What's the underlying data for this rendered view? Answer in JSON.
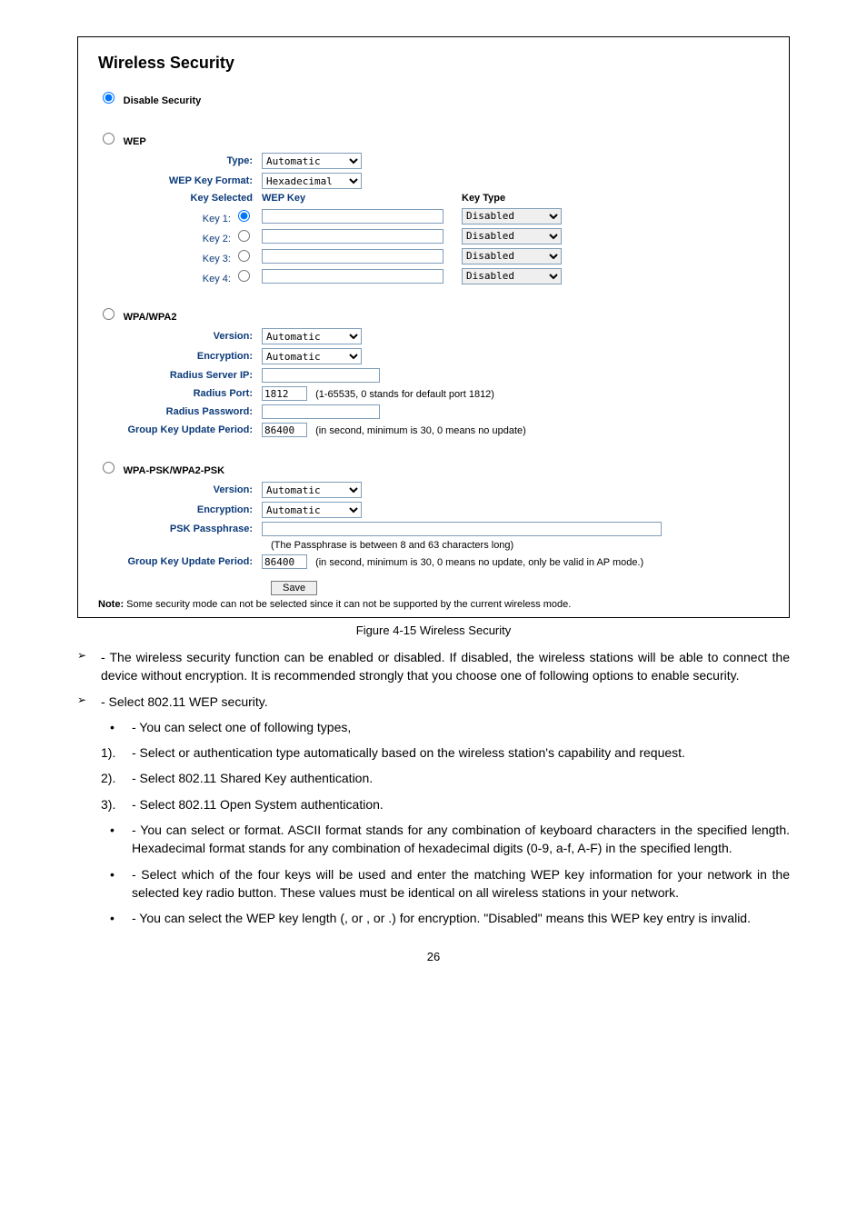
{
  "panel": {
    "title": "Wireless Security",
    "disable_label": "Disable Security",
    "wep": {
      "label": "WEP",
      "type_label": "Type:",
      "type_value": "Automatic",
      "format_label": "WEP Key Format:",
      "format_value": "Hexadecimal",
      "key_selected_label": "Key Selected",
      "wep_key_label": "WEP Key",
      "key_type_label": "Key Type",
      "keys": [
        {
          "label": "Key 1:",
          "type": "Disabled",
          "checked": true
        },
        {
          "label": "Key 2:",
          "type": "Disabled",
          "checked": false
        },
        {
          "label": "Key 3:",
          "type": "Disabled",
          "checked": false
        },
        {
          "label": "Key 4:",
          "type": "Disabled",
          "checked": false
        }
      ]
    },
    "wpa": {
      "label": "WPA/WPA2",
      "version_label": "Version:",
      "version_value": "Automatic",
      "encryption_label": "Encryption:",
      "encryption_value": "Automatic",
      "server_ip_label": "Radius Server IP:",
      "port_label": "Radius Port:",
      "port_value": "1812",
      "port_hint": "(1-65535, 0 stands for default port 1812)",
      "password_label": "Radius Password:",
      "gkup_label": "Group Key Update Period:",
      "gkup_value": "86400",
      "gkup_hint": "(in second, minimum is 30, 0 means no update)"
    },
    "psk": {
      "label": "WPA-PSK/WPA2-PSK",
      "version_label": "Version:",
      "version_value": "Automatic",
      "encryption_label": "Encryption:",
      "encryption_value": "Automatic",
      "pass_label": "PSK Passphrase:",
      "pass_hint": "(The Passphrase is between 8 and 63 characters long)",
      "gkup_label": "Group Key Update Period:",
      "gkup_value": "86400",
      "gkup_hint": "(in second, minimum is 30, 0 means no update, only be valid in AP mode.)"
    },
    "save_label": "Save",
    "note_bold": "Note:",
    "note_text": "  Some security mode can not be selected since it can not be supported by the current wireless mode."
  },
  "caption": "Figure 4-15 Wireless Security",
  "doc": {
    "p1": " - The wireless security function can be enabled or disabled. If disabled, the wireless stations will be able to connect the device without encryption. It is recommended strongly that you choose one of following options to enable security.",
    "p2": " - Select 802.11 WEP security.",
    "b1": " - You can select one of following types,",
    "n1_pre": " - Select ",
    "n1_mid": " or ",
    "n1_post": " authentication type automatically based on the wireless station's capability and request.",
    "n2": " - Select 802.11 Shared Key authentication.",
    "n3": " - Select 802.11 Open System authentication.",
    "b2_pre": " - You can select ",
    "b2_mid": " or ",
    "b2_post": " format. ASCII format stands for any combination of keyboard characters in the specified length. Hexadecimal format stands for any combination of hexadecimal digits (0-9, a-f, A-F) in the specified length.",
    "b3": " - Select which of the four keys will be used and enter the matching WEP key information for your network in the selected key radio button. These values must be identical on all wireless stations in your network.",
    "b4_pre": " - You can select the WEP key length (",
    "b4_m1": ", or ",
    "b4_m2": ", or ",
    "b4_post": ".) for encryption. \"Disabled\" means this WEP key entry is invalid."
  },
  "page_num": "26"
}
